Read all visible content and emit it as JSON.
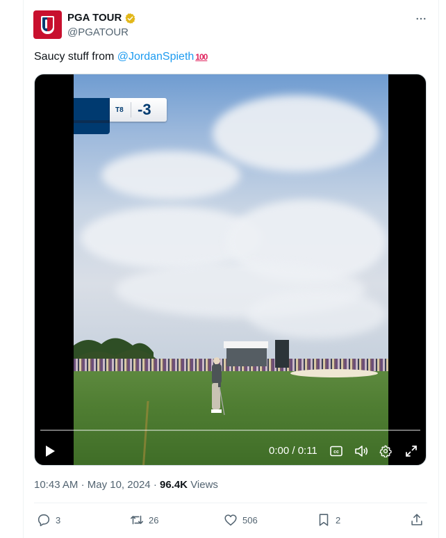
{
  "account": {
    "name": "PGA TOUR",
    "handle": "@PGATOUR",
    "verified_badge_color": "#e2b719",
    "avatar_color": "#c8102e"
  },
  "tweet": {
    "text_prefix": "Saucy stuff from ",
    "mention": "@JordanSpieth",
    "emoji": "100",
    "mention_color": "#1d9bf0"
  },
  "video": {
    "scorebug": {
      "position": "T8",
      "score": "-3"
    },
    "time_display": "0:00 / 0:11",
    "progress": 0.0
  },
  "meta": {
    "time": "10:43 AM",
    "separator": "·",
    "date": "May 10, 2024",
    "views_count": "96.4K",
    "views_label": "Views"
  },
  "actions": {
    "replies": "3",
    "reposts": "26",
    "likes": "506",
    "bookmarks": "2"
  },
  "icons": [
    "verified-badge-icon",
    "more-icon",
    "play-icon",
    "captions-icon",
    "volume-icon",
    "settings-icon",
    "fullscreen-icon",
    "reply-icon",
    "repost-icon",
    "like-icon",
    "bookmark-icon",
    "share-icon"
  ]
}
